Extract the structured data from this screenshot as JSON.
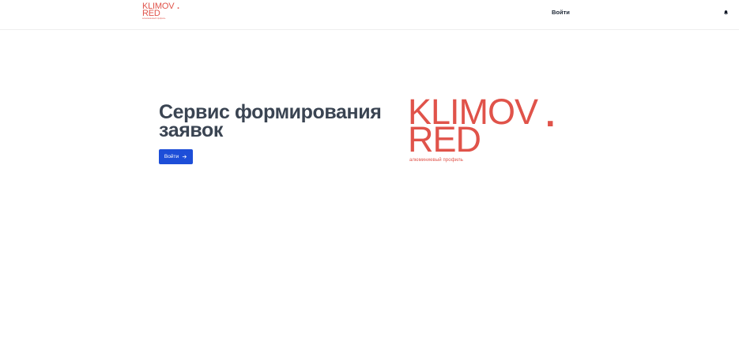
{
  "header": {
    "logo": {
      "line1": "KLIMOV",
      "line2": "RED",
      "dot": ".",
      "subtitle": "aлюминиевый профиль"
    },
    "login_label": "Войти",
    "bell_icon": "bell-icon"
  },
  "hero": {
    "title": "Сервис формирования заявок",
    "button_label": "Войти",
    "button_icon": "arrow-right-icon"
  },
  "brand_logo": {
    "line1": "KLIMOV",
    "line2": "RED",
    "dot": ".",
    "subtitle": "алюминиевый профиль"
  },
  "colors": {
    "brand": "#e0534a",
    "primary_button": "#1d4ed8",
    "title": "#3a4452"
  }
}
